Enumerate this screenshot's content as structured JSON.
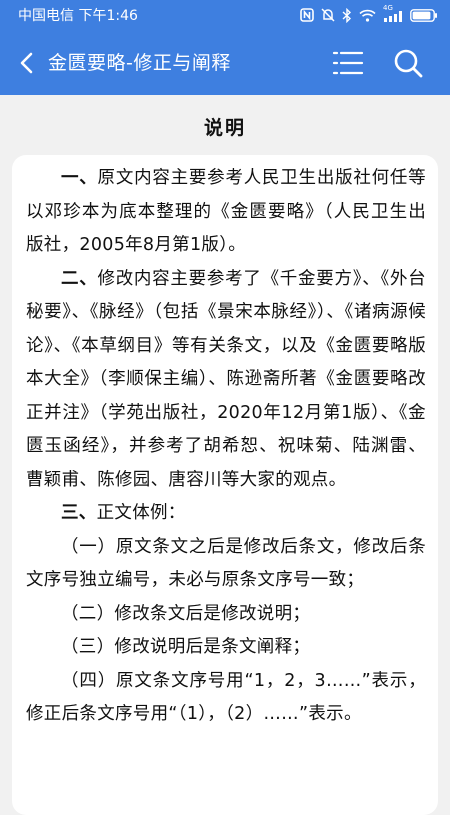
{
  "status_bar": {
    "carrier_time": "中国电信 下午1:46",
    "network_label": "4G",
    "battery_level": 0.9
  },
  "app_bar": {
    "title": "金匮要略-修正与阐释",
    "back_icon": "chevron-left-icon",
    "menu_icon": "menu-lines-icon",
    "search_icon": "search-icon"
  },
  "content": {
    "heading": "说明",
    "paragraphs": [
      {
        "lead": "一、",
        "text": "原文内容主要参考人民卫生出版社何任等以邓珍本为底本整理的《金匮要略》（人民卫生出版社，2005年8月第1版）。"
      },
      {
        "lead": "二、",
        "text": "修改内容主要参考了《千金要方》、《外台秘要》、《脉经》（包括《景宋本脉经》）、《诸病源候论》、《本草纲目》等有关条文，以及《金匮要略版本大全》（李顺保主编）、陈逊斋所著《金匮要略改正并注》（学苑出版社，2020年12月第1版）、《金匮玉函经》，并参考了胡希恕、祝味菊、陆渊雷、曹颖甫、陈修园、唐容川等大家的观点。"
      },
      {
        "lead": "三、",
        "text": "正文体例："
      },
      {
        "lead": "",
        "text": "（一）原文条文之后是修改后条文，修改后条文序号独立编号，未必与原条文序号一致；"
      },
      {
        "lead": "",
        "text": "（二）修改条文后是修改说明；"
      },
      {
        "lead": "",
        "text": "（三）修改说明后是条文阐释；"
      },
      {
        "lead": "",
        "text": "（四）原文条文序号用“1，2，3……”表示，修正后条文序号用“（1），（2）……”表示。"
      }
    ]
  }
}
